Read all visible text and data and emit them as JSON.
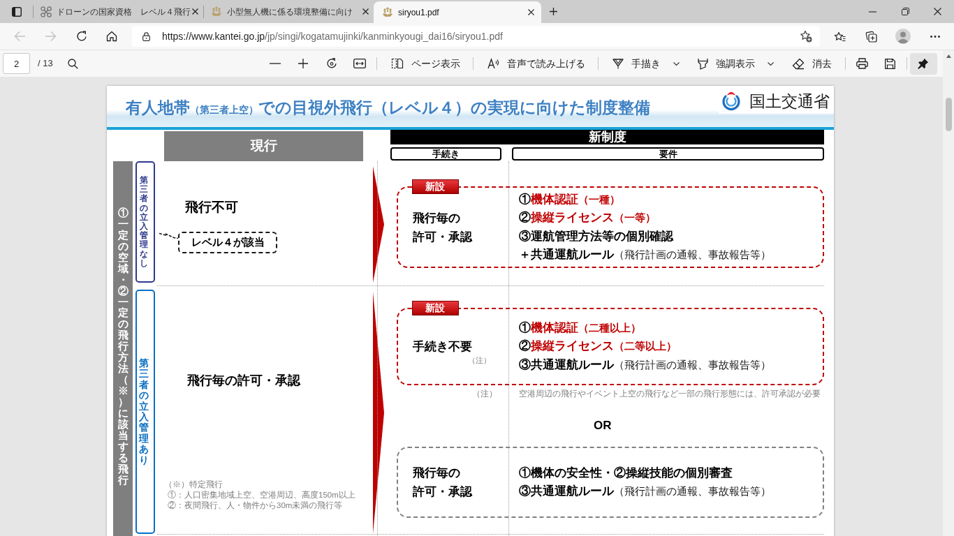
{
  "browser": {
    "tabs": [
      {
        "title": "ドローンの国家資格　レベル４飛行",
        "selected": false
      },
      {
        "title": "小型無人機に係る環境整備に向け",
        "selected": false
      },
      {
        "title": "siryou1.pdf",
        "selected": true
      }
    ],
    "back_disabled": true,
    "forward_disabled": true,
    "address_bar": {
      "url_host": "https://www.kantei.go.jp",
      "url_path": "/jp/singi/kogatamujinki/kanminkyougi_dai16/siryou1.pdf"
    }
  },
  "pdf_toolbar": {
    "page_number": "2",
    "page_count": "/ 13",
    "tools": [
      {
        "label": "ページ表示",
        "kind": "page-view",
        "dropdown": false
      },
      {
        "label": "音声で読み上げる",
        "kind": "read-aloud",
        "dropdown": false
      },
      {
        "label": "手描き",
        "kind": "draw",
        "dropdown": true
      },
      {
        "label": "強調表示",
        "kind": "highlight",
        "dropdown": true
      },
      {
        "label": "消去",
        "kind": "erase",
        "dropdown": false
      }
    ],
    "pinned": true
  },
  "slide": {
    "title": [
      {
        "text": "有人地帯",
        "kind": "large"
      },
      {
        "text": "（第三者上空）",
        "kind": "small"
      },
      {
        "text": "での目視外飛行（レベル４）の実現に向けた制度整備",
        "kind": "large"
      }
    ],
    "agency": "国土交通省",
    "current_heading": "現行",
    "new_heading": "新制度",
    "new_columns": [
      "手続き",
      "要件"
    ],
    "scope": "①一定の空域・②一定の飛行方法（※）に該当する飛行",
    "rows": [
      {
        "category": "第三者の立入管理なし",
        "color": "#2e3a8c",
        "current": "飛行不可",
        "callout": "レベル４が該当",
        "options": [
          {
            "kind": "new",
            "badge": "新設",
            "procedure": [
              "飛行毎の",
              "許可・承認"
            ],
            "requirements": [
              [
                {
                  "text": "①",
                  "kind": "plain"
                },
                {
                  "text": "機体認証",
                  "kind": "highlight"
                },
                {
                  "text": "（一種）",
                  "kind": "highlight-small"
                }
              ],
              [
                {
                  "text": "②",
                  "kind": "plain"
                },
                {
                  "text": "操縦ライセンス",
                  "kind": "highlight"
                },
                {
                  "text": "（一等）",
                  "kind": "highlight-small"
                }
              ],
              [
                {
                  "text": "③運航管理方法等の個別確認",
                  "kind": "plain"
                }
              ],
              [
                {
                  "text": "＋共通運航ルール",
                  "kind": "plain"
                },
                {
                  "text": "（飛行計画の通報、事故報告等）",
                  "kind": "aside"
                }
              ]
            ]
          }
        ]
      },
      {
        "category": "第三者の立入管理あり",
        "color": "#0a6fc2",
        "current": "飛行毎の許可・承認",
        "options": [
          {
            "kind": "new",
            "badge": "新設",
            "procedure": [
              "手続き不要"
            ],
            "procedure_note": "（注）",
            "requirements": [
              [
                {
                  "text": "①",
                  "kind": "plain"
                },
                {
                  "text": "機体認証",
                  "kind": "highlight"
                },
                {
                  "text": "（二種以上）",
                  "kind": "highlight-small"
                }
              ],
              [
                {
                  "text": "②",
                  "kind": "plain"
                },
                {
                  "text": "操縦ライセンス",
                  "kind": "highlight"
                },
                {
                  "text": "（二等以上）",
                  "kind": "highlight-small"
                }
              ],
              [
                {
                  "text": "③共通運航ルール",
                  "kind": "plain"
                },
                {
                  "text": "（飛行計画の通報、事故報告等）",
                  "kind": "aside"
                }
              ]
            ],
            "note": {
              "mark": "（注）",
              "text": "空港周辺の飛行やイベント上空の飛行など一部の飛行形態には、許可承認が必要"
            }
          },
          {
            "kind": "existing",
            "procedure": [
              "飛行毎の",
              "許可・承認"
            ],
            "requirements": [
              [
                {
                  "text": "①機体の安全性・②操縦技能の個別審査",
                  "kind": "plain"
                }
              ],
              [
                {
                  "text": "③共通運航ルール",
                  "kind": "plain"
                },
                {
                  "text": "（飛行計画の通報、事故報告等）",
                  "kind": "aside"
                }
              ]
            ]
          }
        ],
        "separator": "OR",
        "footnote": {
          "title": "（※）特定飛行",
          "items": [
            "①：人口密集地域上空、空港周辺、高度150m以上",
            "②：夜間飛行、人・物件から30m未満の飛行等"
          ]
        }
      }
    ]
  }
}
